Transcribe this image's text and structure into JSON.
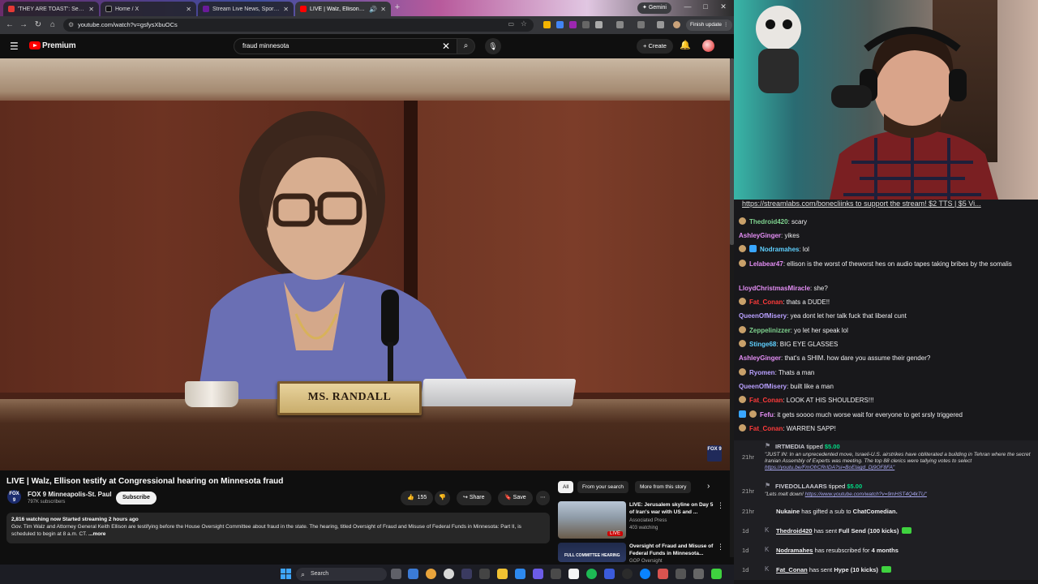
{
  "browser": {
    "tabs": [
      {
        "title": "'THEY ARE TOAST': Sec Hegseth",
        "active": false,
        "color": "#e53935"
      },
      {
        "title": "Home / X",
        "active": false,
        "color": "#000000"
      },
      {
        "title": "Stream Live News, Sports...",
        "active": false,
        "color": "#6a1b9a"
      },
      {
        "title": "LIVE | Walz, Ellison testify at ...",
        "active": true,
        "color": "#ff0000"
      }
    ],
    "gemini_label": "Gemini",
    "url": "youtube.com/watch?v=gsfysXbuOCs",
    "finish_update_label": "Finish update"
  },
  "youtube": {
    "logo_text": "Premium",
    "search_value": "fraud minnesota",
    "create_label": "+ Create",
    "video": {
      "nameplate": "MS. RANDALL",
      "bug": "FOX 9"
    },
    "title": "LIVE | Walz, Ellison testify at Congressional hearing on Minnesota fraud",
    "channel": {
      "name": "FOX 9 Minneapolis-St. Paul",
      "subs": "797K subscribers",
      "logo": "FOX 9"
    },
    "subscribe_label": "Subscribe",
    "likes": "155",
    "share_label": "Share",
    "save_label": "Save",
    "description": {
      "meta": "2,816 watching now  Started streaming 2 hours ago",
      "text": "Gov. Tim Walz and Attorney General Keith Ellison are testifying before the House Oversight Committee about fraud in the state. The hearing, titled Oversight of Fraud and Misuse of Federal Funds in Minnesota: Part II, is scheduled to begin at 8 a.m. CT.",
      "more": "...more"
    },
    "chips": [
      "All",
      "From your search",
      "More from this story"
    ],
    "recommendations": [
      {
        "title": "LIVE: Jerusalem skyline on Day 5 of Iran's war with US and ...",
        "channel": "Associated Press",
        "meta": "403 watching",
        "badge": "LIVE"
      },
      {
        "title": "Oversight of Fraud and Misuse of Federal Funds in Minnesota...",
        "channel": "GOP Oversight",
        "meta": "",
        "thumb_caption": "FULL COMMITTEE HEARING"
      }
    ]
  },
  "taskbar": {
    "search_placeholder": "Search"
  },
  "chat": {
    "banner": "https://streamlabs.com/bonecliinks to support the stream! $2 TTS | $5 Vi...",
    "messages": [
      {
        "user": "Thedroid420",
        "color": "#7fd38f",
        "text": "scary"
      },
      {
        "user": "AshleyGinger",
        "color": "#e48ef5",
        "text": "yikes"
      },
      {
        "user": "Nodramahes",
        "color": "#5fd0ff",
        "text": "lol"
      },
      {
        "user": "Lelabear47",
        "color": "#e48ef5",
        "text": "ellison is the worst of theworst hes on audio tapes taking bribes by the somalis"
      },
      {
        "user": "LloydChristmasMiracle",
        "color": "#e48ef5",
        "text": "she?"
      },
      {
        "user": "Fat_Conan",
        "color": "#ff3b3b",
        "text": "thats a DUDE!!"
      },
      {
        "user": "QueenOfMisery",
        "color": "#b9a0ff",
        "text": "yea dont let her talk fuck that liberal cunt"
      },
      {
        "user": "Zeppelinizzer",
        "color": "#7fd38f",
        "text": "yo let her speak lol"
      },
      {
        "user": "Stinge68",
        "color": "#5fd0ff",
        "text": "BIG EYE GLASSES"
      },
      {
        "user": "AshleyGinger",
        "color": "#e48ef5",
        "text": "that's a SHIM. how dare you assume their gender?"
      },
      {
        "user": "Ryomen",
        "color": "#b9a0ff",
        "text": "Thats a man"
      },
      {
        "user": "QueenOfMisery",
        "color": "#b9a0ff",
        "text": "built like a man"
      },
      {
        "user": "Fat_Conan",
        "color": "#ff3b3b",
        "text": "LOOK AT HIS SHOULDERS!!!"
      },
      {
        "user": "Fefu",
        "color": "#e48ef5",
        "text": "it gets soooo much worse wait for everyone to get srsly triggered"
      },
      {
        "user": "Fat_Conan",
        "color": "#ff3b3b",
        "text": "WARREN SAPP!"
      }
    ],
    "events": [
      {
        "time": "21hr",
        "user": "IRTMEDIA",
        "action": "tipped",
        "amount": "$5.00",
        "quote": "\"JUST IN: In an unprecedented move, Israeli-U.S. airstrikes have obliterated a building in Tehran where the secret Iranian Assembly of Experts was meeting. The top 88 clerics were tallying votes to select",
        "link": "https://youtu.be/FmOfrCRrIDA?si=BoEtagd_Dj9OF8FA\""
      },
      {
        "time": "21hr",
        "user": "FIVEDOLLAAARS",
        "action": "tipped",
        "amount": "$5.00",
        "quote": "\"Lets melt down!",
        "link": "https://www.youtube.com/watch?v=9mHST4Q4kTU\""
      },
      {
        "time": "21hr",
        "user": "Nukaine",
        "action": "has gifted a sub to",
        "target": "ChatComedian."
      },
      {
        "time": "1d",
        "user": "Thedroid420",
        "action": "has sent",
        "target": "Full Send (100 kicks)"
      },
      {
        "time": "1d",
        "user": "Nodramahes",
        "action": "has resubscribed for",
        "target": "4 months"
      },
      {
        "time": "1d",
        "user": "Fat_Conan",
        "action": "has sent",
        "target": "Hype (10 kicks)"
      }
    ]
  }
}
